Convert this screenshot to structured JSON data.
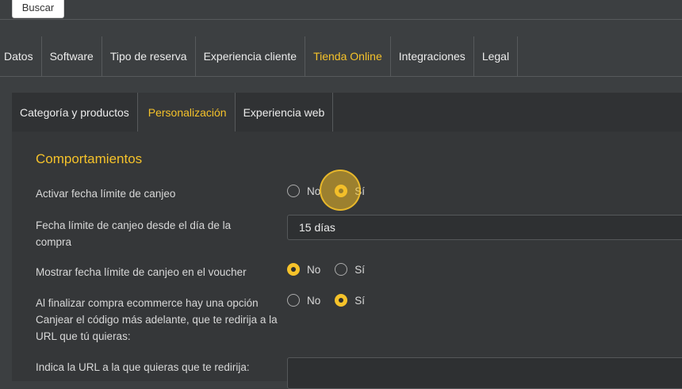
{
  "topbar": {
    "search_button": "Buscar"
  },
  "main_tabs": [
    {
      "label": "Datos",
      "active": false
    },
    {
      "label": "Software",
      "active": false
    },
    {
      "label": "Tipo de reserva",
      "active": false
    },
    {
      "label": "Experiencia cliente",
      "active": false
    },
    {
      "label": "Tienda Online",
      "active": true
    },
    {
      "label": "Integraciones",
      "active": false
    },
    {
      "label": "Legal",
      "active": false
    }
  ],
  "sub_tabs": [
    {
      "label": "Categoría y productos",
      "active": false
    },
    {
      "label": "Personalización",
      "active": true
    },
    {
      "label": "Experiencia web",
      "active": false
    }
  ],
  "section": {
    "title": "Comportamientos",
    "fields": [
      {
        "label": "Activar fecha límite de canjeo",
        "type": "radio",
        "options": [
          "No",
          "Sí"
        ],
        "selected": "Sí"
      },
      {
        "label": "Fecha límite de canjeo desde el día de la compra",
        "type": "input",
        "value": "15 días"
      },
      {
        "label": "Mostrar fecha límite de canjeo en el voucher",
        "type": "radio",
        "options": [
          "No",
          "Sí"
        ],
        "selected": "No"
      },
      {
        "label": "Al finalizar compra ecommerce hay una opción Canjear el código más adelante, que te redirija a la URL que tú quieras:",
        "type": "radio",
        "options": [
          "No",
          "Sí"
        ],
        "selected": "Sí"
      },
      {
        "label": "Indica la URL a la que quieras que te redirija:",
        "type": "input",
        "value": ""
      }
    ]
  },
  "colors": {
    "accent": "#f5c22a",
    "background": "#3c3f41",
    "panel": "#353739"
  }
}
